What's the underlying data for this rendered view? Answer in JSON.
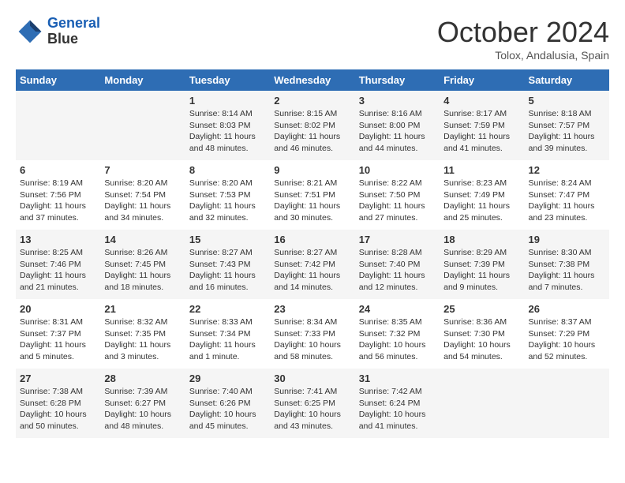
{
  "header": {
    "logo_line1": "General",
    "logo_line2": "Blue",
    "month": "October 2024",
    "location": "Tolox, Andalusia, Spain"
  },
  "columns": [
    "Sunday",
    "Monday",
    "Tuesday",
    "Wednesday",
    "Thursday",
    "Friday",
    "Saturday"
  ],
  "weeks": [
    [
      {
        "day": "",
        "info": ""
      },
      {
        "day": "",
        "info": ""
      },
      {
        "day": "1",
        "info": "Sunrise: 8:14 AM\nSunset: 8:03 PM\nDaylight: 11 hours and 48 minutes."
      },
      {
        "day": "2",
        "info": "Sunrise: 8:15 AM\nSunset: 8:02 PM\nDaylight: 11 hours and 46 minutes."
      },
      {
        "day": "3",
        "info": "Sunrise: 8:16 AM\nSunset: 8:00 PM\nDaylight: 11 hours and 44 minutes."
      },
      {
        "day": "4",
        "info": "Sunrise: 8:17 AM\nSunset: 7:59 PM\nDaylight: 11 hours and 41 minutes."
      },
      {
        "day": "5",
        "info": "Sunrise: 8:18 AM\nSunset: 7:57 PM\nDaylight: 11 hours and 39 minutes."
      }
    ],
    [
      {
        "day": "6",
        "info": "Sunrise: 8:19 AM\nSunset: 7:56 PM\nDaylight: 11 hours and 37 minutes."
      },
      {
        "day": "7",
        "info": "Sunrise: 8:20 AM\nSunset: 7:54 PM\nDaylight: 11 hours and 34 minutes."
      },
      {
        "day": "8",
        "info": "Sunrise: 8:20 AM\nSunset: 7:53 PM\nDaylight: 11 hours and 32 minutes."
      },
      {
        "day": "9",
        "info": "Sunrise: 8:21 AM\nSunset: 7:51 PM\nDaylight: 11 hours and 30 minutes."
      },
      {
        "day": "10",
        "info": "Sunrise: 8:22 AM\nSunset: 7:50 PM\nDaylight: 11 hours and 27 minutes."
      },
      {
        "day": "11",
        "info": "Sunrise: 8:23 AM\nSunset: 7:49 PM\nDaylight: 11 hours and 25 minutes."
      },
      {
        "day": "12",
        "info": "Sunrise: 8:24 AM\nSunset: 7:47 PM\nDaylight: 11 hours and 23 minutes."
      }
    ],
    [
      {
        "day": "13",
        "info": "Sunrise: 8:25 AM\nSunset: 7:46 PM\nDaylight: 11 hours and 21 minutes."
      },
      {
        "day": "14",
        "info": "Sunrise: 8:26 AM\nSunset: 7:45 PM\nDaylight: 11 hours and 18 minutes."
      },
      {
        "day": "15",
        "info": "Sunrise: 8:27 AM\nSunset: 7:43 PM\nDaylight: 11 hours and 16 minutes."
      },
      {
        "day": "16",
        "info": "Sunrise: 8:27 AM\nSunset: 7:42 PM\nDaylight: 11 hours and 14 minutes."
      },
      {
        "day": "17",
        "info": "Sunrise: 8:28 AM\nSunset: 7:40 PM\nDaylight: 11 hours and 12 minutes."
      },
      {
        "day": "18",
        "info": "Sunrise: 8:29 AM\nSunset: 7:39 PM\nDaylight: 11 hours and 9 minutes."
      },
      {
        "day": "19",
        "info": "Sunrise: 8:30 AM\nSunset: 7:38 PM\nDaylight: 11 hours and 7 minutes."
      }
    ],
    [
      {
        "day": "20",
        "info": "Sunrise: 8:31 AM\nSunset: 7:37 PM\nDaylight: 11 hours and 5 minutes."
      },
      {
        "day": "21",
        "info": "Sunrise: 8:32 AM\nSunset: 7:35 PM\nDaylight: 11 hours and 3 minutes."
      },
      {
        "day": "22",
        "info": "Sunrise: 8:33 AM\nSunset: 7:34 PM\nDaylight: 11 hours and 1 minute."
      },
      {
        "day": "23",
        "info": "Sunrise: 8:34 AM\nSunset: 7:33 PM\nDaylight: 10 hours and 58 minutes."
      },
      {
        "day": "24",
        "info": "Sunrise: 8:35 AM\nSunset: 7:32 PM\nDaylight: 10 hours and 56 minutes."
      },
      {
        "day": "25",
        "info": "Sunrise: 8:36 AM\nSunset: 7:30 PM\nDaylight: 10 hours and 54 minutes."
      },
      {
        "day": "26",
        "info": "Sunrise: 8:37 AM\nSunset: 7:29 PM\nDaylight: 10 hours and 52 minutes."
      }
    ],
    [
      {
        "day": "27",
        "info": "Sunrise: 7:38 AM\nSunset: 6:28 PM\nDaylight: 10 hours and 50 minutes."
      },
      {
        "day": "28",
        "info": "Sunrise: 7:39 AM\nSunset: 6:27 PM\nDaylight: 10 hours and 48 minutes."
      },
      {
        "day": "29",
        "info": "Sunrise: 7:40 AM\nSunset: 6:26 PM\nDaylight: 10 hours and 45 minutes."
      },
      {
        "day": "30",
        "info": "Sunrise: 7:41 AM\nSunset: 6:25 PM\nDaylight: 10 hours and 43 minutes."
      },
      {
        "day": "31",
        "info": "Sunrise: 7:42 AM\nSunset: 6:24 PM\nDaylight: 10 hours and 41 minutes."
      },
      {
        "day": "",
        "info": ""
      },
      {
        "day": "",
        "info": ""
      }
    ]
  ]
}
